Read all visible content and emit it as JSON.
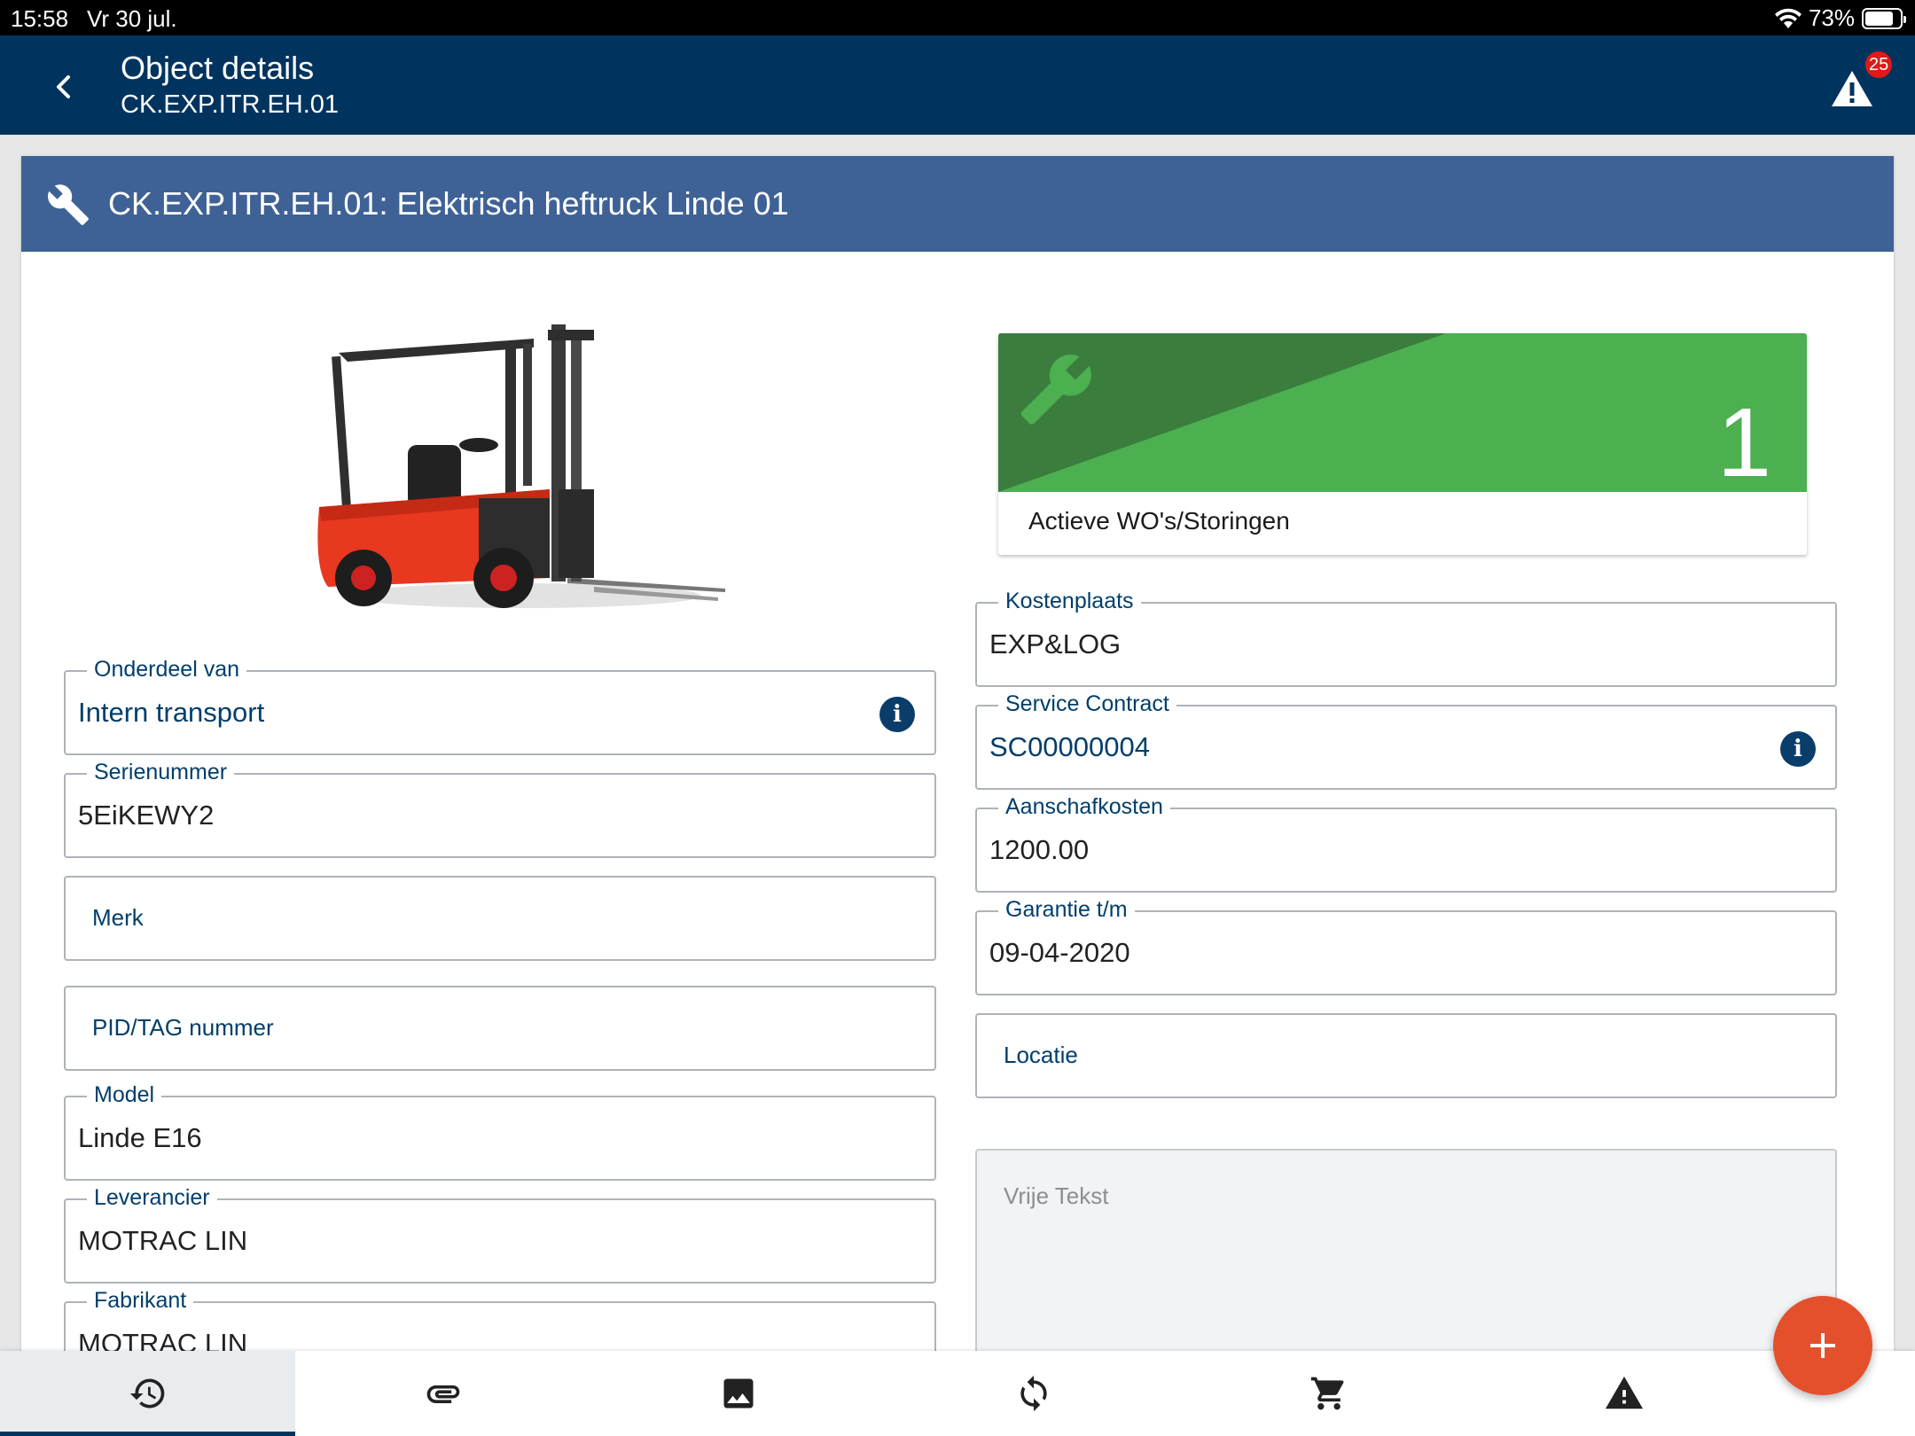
{
  "status_bar": {
    "time": "15:58",
    "date": "Vr 30 jul.",
    "battery_percent": "73%",
    "battery_level": 0.73
  },
  "app_bar": {
    "title": "Object details",
    "subtitle": "CK.EXP.ITR.EH.01",
    "alert_count": "25",
    "back_icon": "chevron-left-icon",
    "alert_icon": "warning-icon"
  },
  "card": {
    "title": "CK.EXP.ITR.EH.01: Elektrisch heftruck Linde 01",
    "header_icon": "wrench-icon",
    "image": "forklift-image"
  },
  "tile": {
    "count": "1",
    "label": "Actieve WO's/Storingen",
    "color_dark": "#3a7d3d",
    "color_light": "#4caf50"
  },
  "left_fields": [
    {
      "label": "Onderdeel van",
      "value": "Intern transport"
    },
    {
      "label": "Serienummer",
      "value": "5EiKEWY2"
    },
    {
      "label": "Merk",
      "value": ""
    },
    {
      "label": "PID/TAG nummer",
      "value": ""
    },
    {
      "label": "Model",
      "value": "Linde E16"
    },
    {
      "label": "Leverancier",
      "value": "MOTRAC LIN"
    },
    {
      "label": "Fabrikant",
      "value": "MOTRAC LIN"
    }
  ],
  "right_fields": [
    {
      "label": "Kostenplaats",
      "value": "EXP&LOG"
    },
    {
      "label": "Service Contract",
      "value": "SC00000004"
    },
    {
      "label": "Aanschafkosten",
      "value": "1200.00"
    },
    {
      "label": "Garantie t/m",
      "value": "09-04-2020"
    },
    {
      "label": "Locatie",
      "value": ""
    }
  ],
  "free_text": {
    "placeholder": "Vrije Tekst"
  },
  "bottom_nav": [
    {
      "icon": "history-icon",
      "active": true
    },
    {
      "icon": "paperclip-icon",
      "active": false
    },
    {
      "icon": "image-icon",
      "active": false
    },
    {
      "icon": "sync-icon",
      "active": false
    },
    {
      "icon": "cart-icon",
      "active": false
    },
    {
      "icon": "warning-icon",
      "active": false
    }
  ],
  "fab": {
    "icon": "plus-icon",
    "color": "#e4502b"
  },
  "colors": {
    "primary": "#00345f",
    "card_header": "#3f6296",
    "field_label": "#003e6b"
  }
}
